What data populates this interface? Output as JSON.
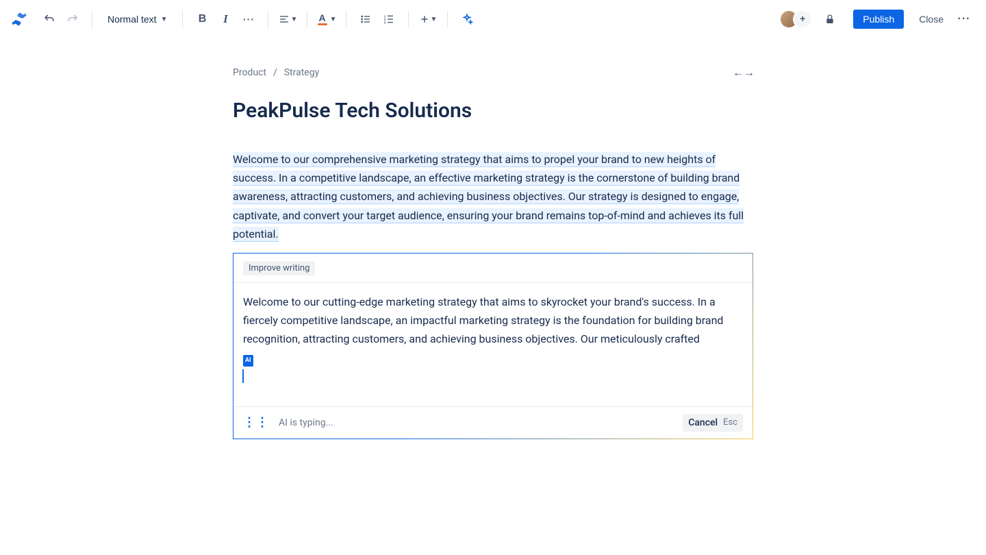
{
  "toolbar": {
    "textStyle": "Normal text",
    "publish": "Publish",
    "close": "Close",
    "addAvatar": "+"
  },
  "breadcrumb": {
    "items": [
      "Product",
      "Strategy"
    ],
    "separator": "/"
  },
  "page": {
    "title": "PeakPulse Tech Solutions",
    "paragraph": "Welcome to our comprehensive marketing strategy that aims to propel your brand to new heights of success. In a competitive landscape, an effective marketing strategy is the cornerstone of building brand awareness, attracting customers, and achieving business objectives. Our strategy is designed to engage, captivate, and convert your target audience, ensuring your brand remains top-of-mind and achieves its full potential."
  },
  "aiPanel": {
    "tag": "Improve writing",
    "suggestion": "Welcome to our cutting-edge marketing strategy that aims to skyrocket your brand's success. In a fiercely competitive landscape, an impactful marketing strategy is the foundation for building brand recognition, attracting customers, and achieving business objectives. Our meticulously crafted",
    "cursorBadge": "AI",
    "typingStatus": "AI is typing...",
    "cancel": "Cancel",
    "escHint": "Esc"
  }
}
